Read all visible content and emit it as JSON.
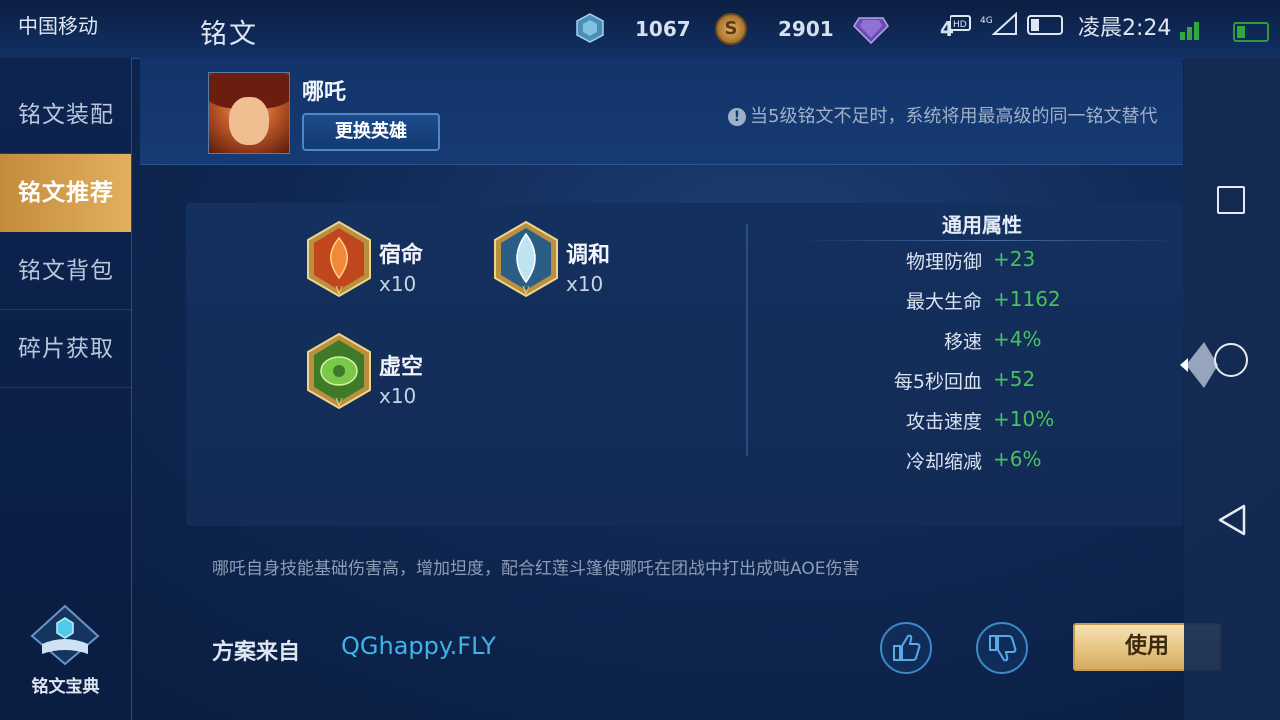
{
  "status_bar": {
    "carrier": "中国移动",
    "time": "凌晨2:24"
  },
  "header": {
    "title": "铭文"
  },
  "currencies": {
    "diamond": "1067",
    "coin": "2901",
    "gem": "4"
  },
  "sidebar": {
    "items": [
      {
        "label": "铭文装配"
      },
      {
        "label": "铭文推荐"
      },
      {
        "label": "铭文背包"
      },
      {
        "label": "碎片获取"
      }
    ],
    "active_index": 1,
    "bottom_label": "铭文宝典"
  },
  "hero": {
    "name": "哪吒",
    "change_button": "更换英雄"
  },
  "notice": "当5级铭文不足时，系统将用最高级的同一铭文替代",
  "runes": [
    {
      "name": "宿命",
      "count": "x10",
      "color": "#c0461c"
    },
    {
      "name": "调和",
      "count": "x10",
      "color": "#bfe3f0"
    },
    {
      "name": "虚空",
      "count": "x10",
      "color": "#5ca83a"
    }
  ],
  "attributes": {
    "title": "通用属性",
    "rows": [
      {
        "name": "物理防御",
        "value": "+23"
      },
      {
        "name": "最大生命",
        "value": "+1162"
      },
      {
        "name": "移速",
        "value": "+4%"
      },
      {
        "name": "每5秒回血",
        "value": "+52"
      },
      {
        "name": "攻击速度",
        "value": "+10%"
      },
      {
        "name": "冷却缩减",
        "value": "+6%"
      }
    ],
    "value_color": "#46c25a"
  },
  "description": "哪吒自身技能基础伤害高，增加坦度，配合红莲斗篷使哪吒在团战中打出成吨AOE伤害",
  "source": {
    "label": "方案来自",
    "author": "QGhappy.FLY"
  },
  "actions": {
    "use_label": "使用"
  },
  "colors": {
    "accent_gold": "#e2b060",
    "link_blue": "#3fb4e8"
  }
}
